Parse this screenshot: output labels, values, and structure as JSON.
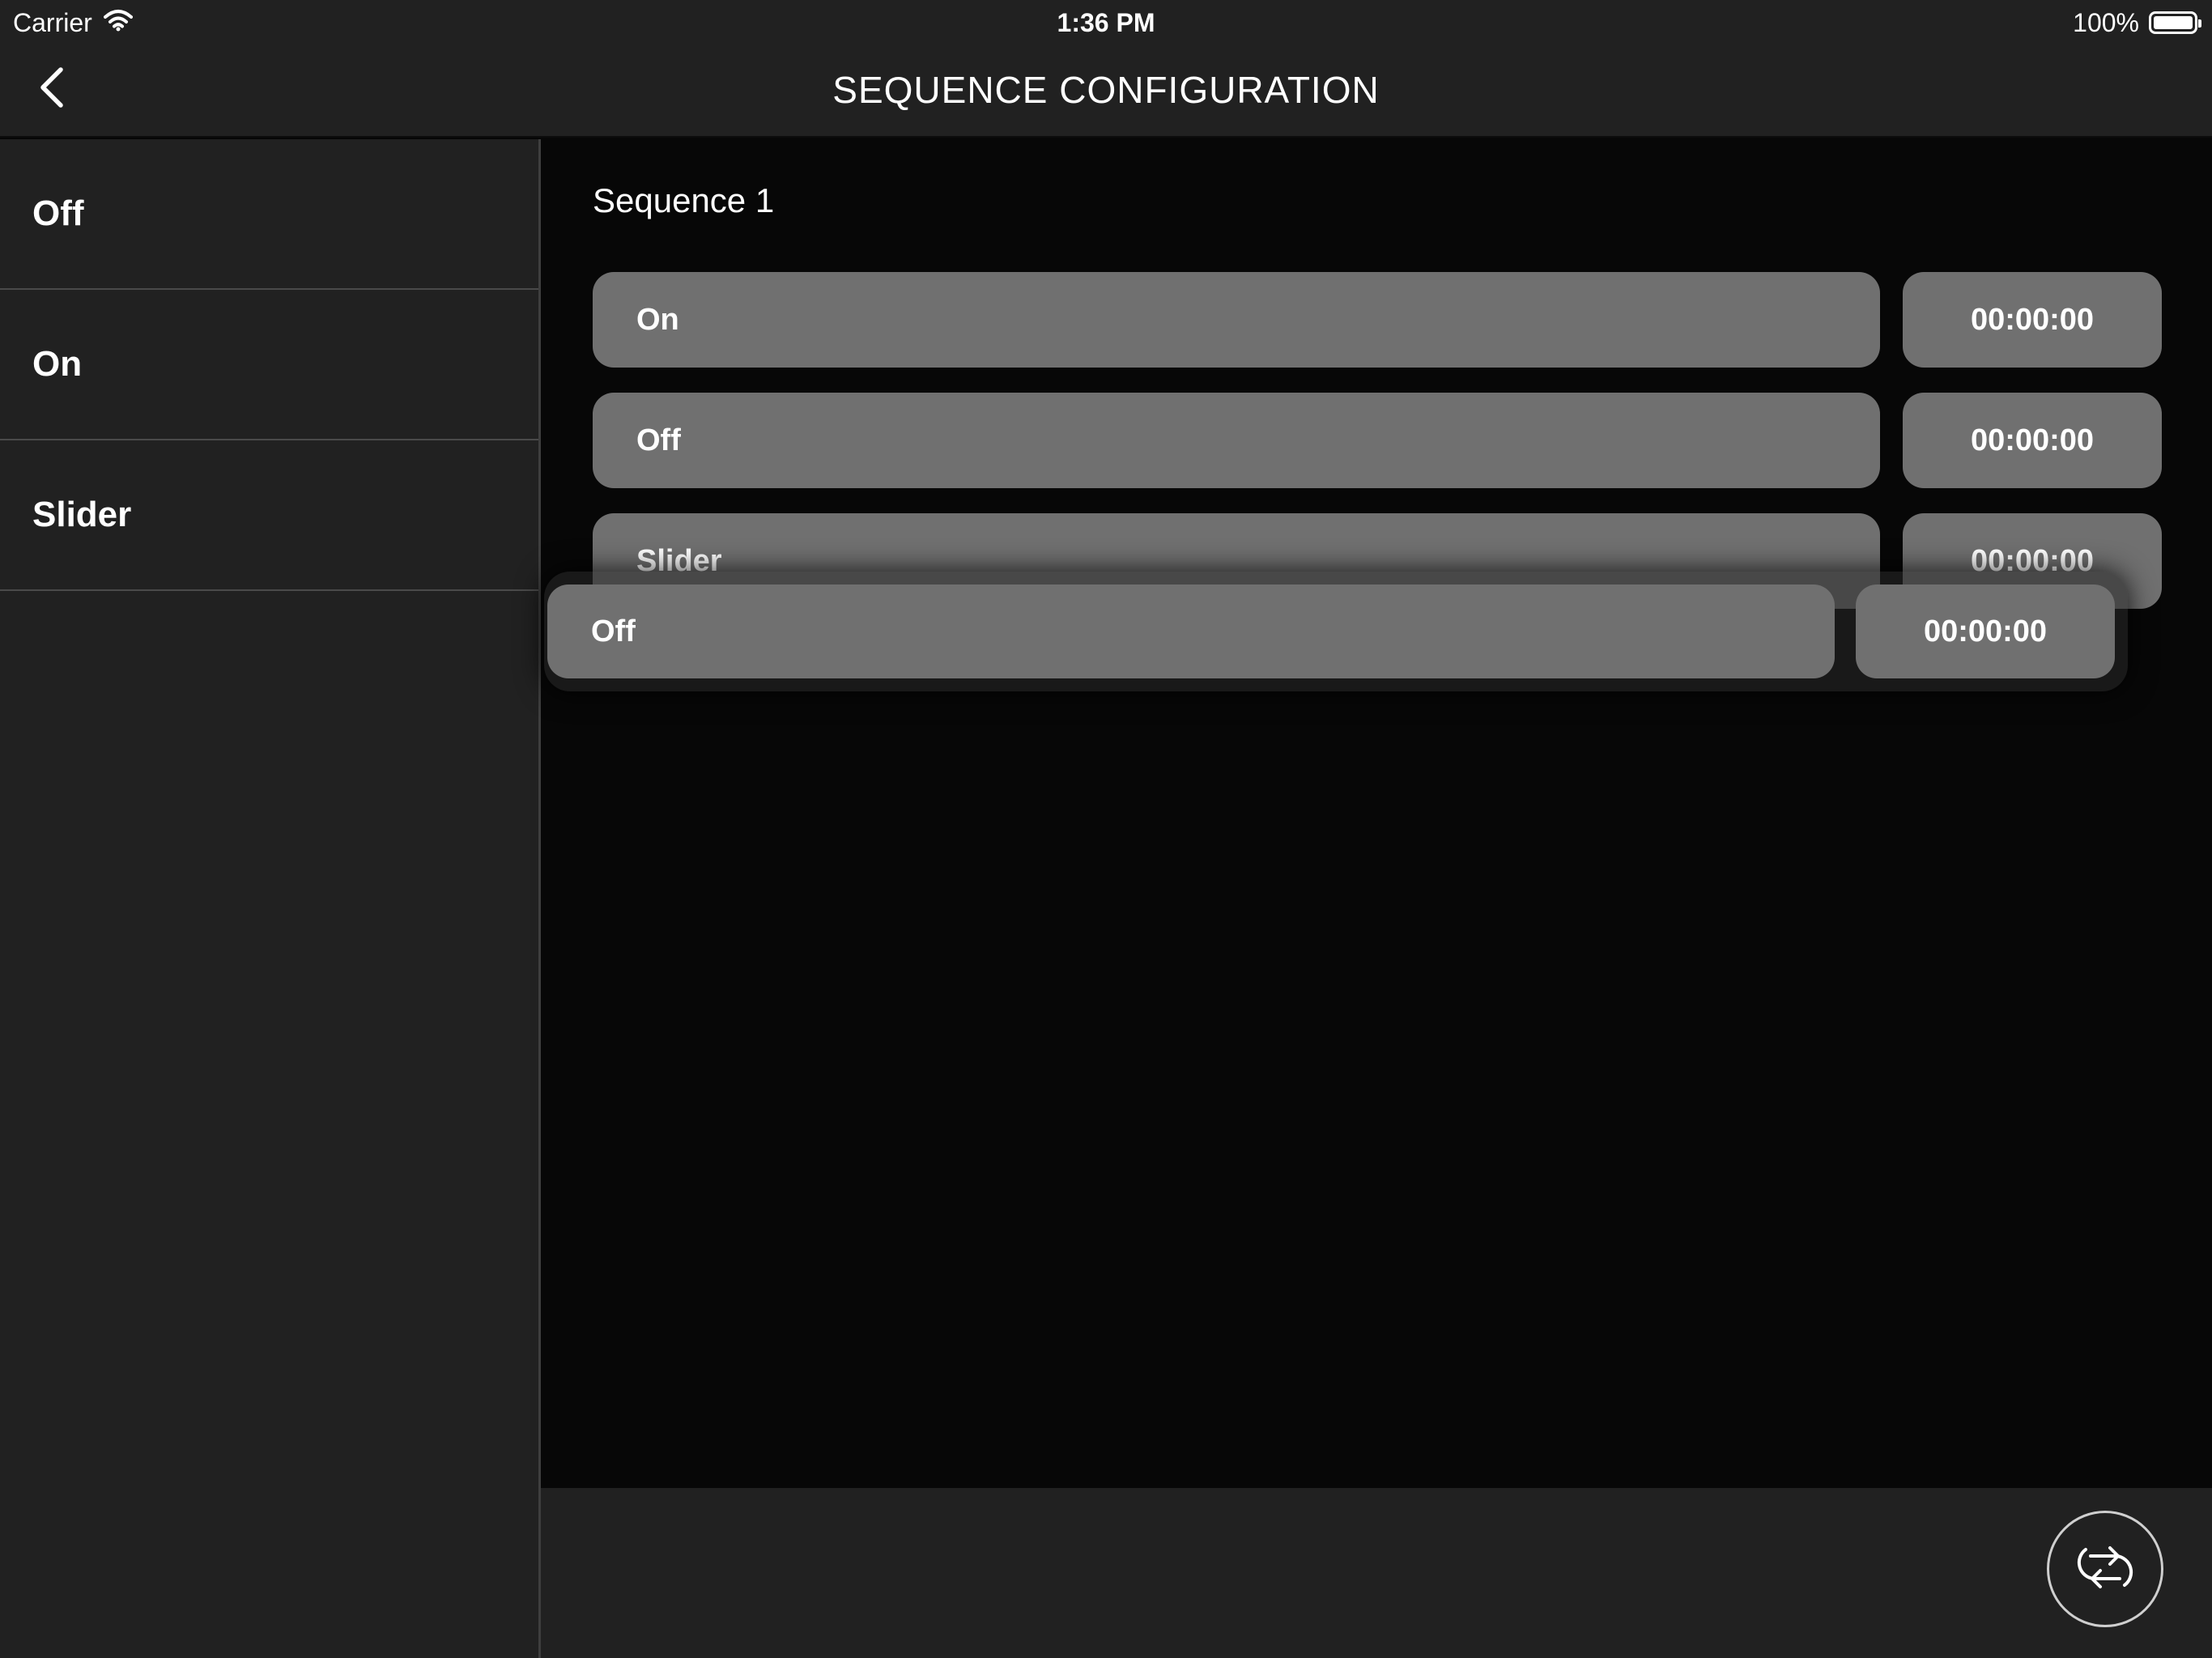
{
  "status_bar": {
    "carrier": "Carrier",
    "time": "1:36 PM",
    "battery_percent": "100%"
  },
  "nav": {
    "title": "SEQUENCE CONFIGURATION"
  },
  "sidebar": {
    "items": [
      {
        "label": "Off"
      },
      {
        "label": "On"
      },
      {
        "label": "Slider"
      }
    ]
  },
  "sequence": {
    "name": "Sequence 1",
    "steps": [
      {
        "action": "On",
        "time": "00:00:00"
      },
      {
        "action": "Off",
        "time": "00:00:00"
      },
      {
        "action": "Slider",
        "time": "00:00:00"
      }
    ],
    "dragging_step": {
      "action": "Off",
      "time": "00:00:00"
    }
  },
  "colors": {
    "background": "#070707",
    "panel": "#212121",
    "step_fill": "#707070",
    "text": "#ffffff"
  },
  "icons": {
    "back": "chevron-left-icon",
    "wifi": "wifi-icon",
    "battery": "battery-icon",
    "loop": "loop-icon"
  }
}
